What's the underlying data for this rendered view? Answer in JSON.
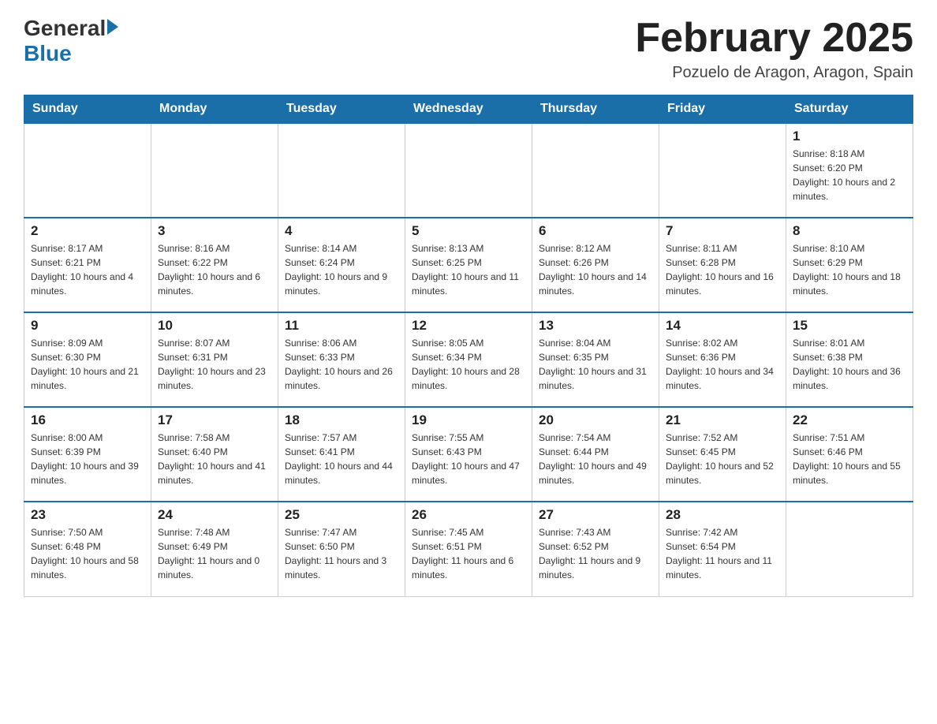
{
  "header": {
    "logo_general": "General",
    "logo_blue": "Blue",
    "title": "February 2025",
    "location": "Pozuelo de Aragon, Aragon, Spain"
  },
  "weekdays": [
    "Sunday",
    "Monday",
    "Tuesday",
    "Wednesday",
    "Thursday",
    "Friday",
    "Saturday"
  ],
  "weeks": [
    [
      {
        "day": "",
        "info": ""
      },
      {
        "day": "",
        "info": ""
      },
      {
        "day": "",
        "info": ""
      },
      {
        "day": "",
        "info": ""
      },
      {
        "day": "",
        "info": ""
      },
      {
        "day": "",
        "info": ""
      },
      {
        "day": "1",
        "info": "Sunrise: 8:18 AM\nSunset: 6:20 PM\nDaylight: 10 hours and 2 minutes."
      }
    ],
    [
      {
        "day": "2",
        "info": "Sunrise: 8:17 AM\nSunset: 6:21 PM\nDaylight: 10 hours and 4 minutes."
      },
      {
        "day": "3",
        "info": "Sunrise: 8:16 AM\nSunset: 6:22 PM\nDaylight: 10 hours and 6 minutes."
      },
      {
        "day": "4",
        "info": "Sunrise: 8:14 AM\nSunset: 6:24 PM\nDaylight: 10 hours and 9 minutes."
      },
      {
        "day": "5",
        "info": "Sunrise: 8:13 AM\nSunset: 6:25 PM\nDaylight: 10 hours and 11 minutes."
      },
      {
        "day": "6",
        "info": "Sunrise: 8:12 AM\nSunset: 6:26 PM\nDaylight: 10 hours and 14 minutes."
      },
      {
        "day": "7",
        "info": "Sunrise: 8:11 AM\nSunset: 6:28 PM\nDaylight: 10 hours and 16 minutes."
      },
      {
        "day": "8",
        "info": "Sunrise: 8:10 AM\nSunset: 6:29 PM\nDaylight: 10 hours and 18 minutes."
      }
    ],
    [
      {
        "day": "9",
        "info": "Sunrise: 8:09 AM\nSunset: 6:30 PM\nDaylight: 10 hours and 21 minutes."
      },
      {
        "day": "10",
        "info": "Sunrise: 8:07 AM\nSunset: 6:31 PM\nDaylight: 10 hours and 23 minutes."
      },
      {
        "day": "11",
        "info": "Sunrise: 8:06 AM\nSunset: 6:33 PM\nDaylight: 10 hours and 26 minutes."
      },
      {
        "day": "12",
        "info": "Sunrise: 8:05 AM\nSunset: 6:34 PM\nDaylight: 10 hours and 28 minutes."
      },
      {
        "day": "13",
        "info": "Sunrise: 8:04 AM\nSunset: 6:35 PM\nDaylight: 10 hours and 31 minutes."
      },
      {
        "day": "14",
        "info": "Sunrise: 8:02 AM\nSunset: 6:36 PM\nDaylight: 10 hours and 34 minutes."
      },
      {
        "day": "15",
        "info": "Sunrise: 8:01 AM\nSunset: 6:38 PM\nDaylight: 10 hours and 36 minutes."
      }
    ],
    [
      {
        "day": "16",
        "info": "Sunrise: 8:00 AM\nSunset: 6:39 PM\nDaylight: 10 hours and 39 minutes."
      },
      {
        "day": "17",
        "info": "Sunrise: 7:58 AM\nSunset: 6:40 PM\nDaylight: 10 hours and 41 minutes."
      },
      {
        "day": "18",
        "info": "Sunrise: 7:57 AM\nSunset: 6:41 PM\nDaylight: 10 hours and 44 minutes."
      },
      {
        "day": "19",
        "info": "Sunrise: 7:55 AM\nSunset: 6:43 PM\nDaylight: 10 hours and 47 minutes."
      },
      {
        "day": "20",
        "info": "Sunrise: 7:54 AM\nSunset: 6:44 PM\nDaylight: 10 hours and 49 minutes."
      },
      {
        "day": "21",
        "info": "Sunrise: 7:52 AM\nSunset: 6:45 PM\nDaylight: 10 hours and 52 minutes."
      },
      {
        "day": "22",
        "info": "Sunrise: 7:51 AM\nSunset: 6:46 PM\nDaylight: 10 hours and 55 minutes."
      }
    ],
    [
      {
        "day": "23",
        "info": "Sunrise: 7:50 AM\nSunset: 6:48 PM\nDaylight: 10 hours and 58 minutes."
      },
      {
        "day": "24",
        "info": "Sunrise: 7:48 AM\nSunset: 6:49 PM\nDaylight: 11 hours and 0 minutes."
      },
      {
        "day": "25",
        "info": "Sunrise: 7:47 AM\nSunset: 6:50 PM\nDaylight: 11 hours and 3 minutes."
      },
      {
        "day": "26",
        "info": "Sunrise: 7:45 AM\nSunset: 6:51 PM\nDaylight: 11 hours and 6 minutes."
      },
      {
        "day": "27",
        "info": "Sunrise: 7:43 AM\nSunset: 6:52 PM\nDaylight: 11 hours and 9 minutes."
      },
      {
        "day": "28",
        "info": "Sunrise: 7:42 AM\nSunset: 6:54 PM\nDaylight: 11 hours and 11 minutes."
      },
      {
        "day": "",
        "info": ""
      }
    ]
  ]
}
